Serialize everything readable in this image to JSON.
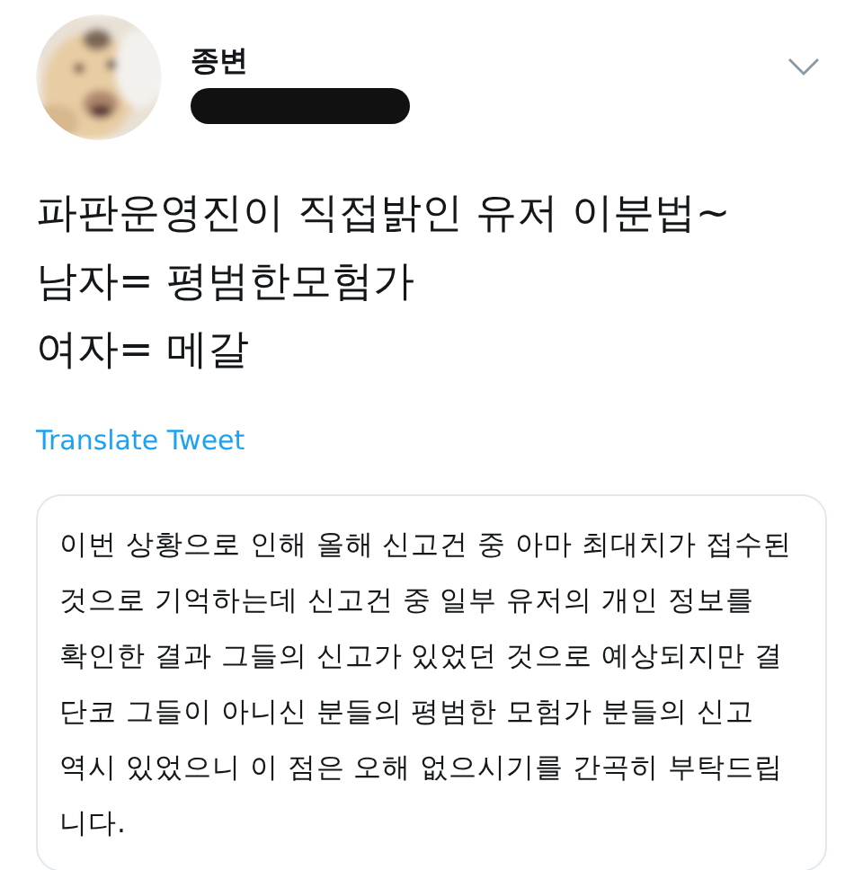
{
  "author": {
    "name": "종변",
    "handle_redacted": true
  },
  "tweet_text": "파판운영진이 직접밝인 유저 이분법~\n남자= 평범한모험가\n여자= 메갈",
  "translate_link": "Translate Tweet",
  "quoted_text": "이번 상황으로 인해 올해 신고건 중 아마 최대치가 접수된\n것으로 기억하는데 신고건 중 일부 유저의 개인 정보를\n확인한 결과 그들의 신고가 있었던 것으로 예상되지만 결\n단코 그들이 아니신 분들의 평범한 모험가 분들의 신고\n역시 있었으니 이 점은 오해 없으시기를 간곡히 부탁드립\n니다."
}
